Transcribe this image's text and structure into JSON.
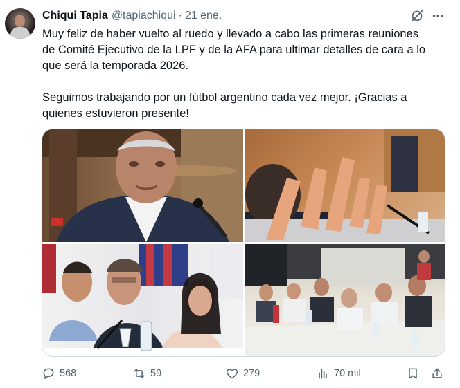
{
  "tweet": {
    "author_name": "Chiqui Tapia",
    "handle": "@tapiachiqui",
    "separator": "·",
    "date": "21 ene.",
    "paragraphs": [
      "Muy feliz de haber vuelto al ruedo y llevado a cabo las primeras reuniones\nde Comité Ejecutivo de la LPF y de la AFA para ultimar detalles de cara a lo\nque será la temporada 2026.",
      "Seguimos trabajando por un fútbol argentino cada vez mejor. ¡Gracias a\nquienes estuvieron presente!"
    ],
    "media": [
      {
        "description_icon": "photo-portrait-man-with-microphone"
      },
      {
        "description_icon": "photo-raised-hands-vote"
      },
      {
        "description_icon": "photo-three-people-at-table"
      },
      {
        "description_icon": "photo-meeting-room-table"
      }
    ],
    "metrics": {
      "replies": "568",
      "reposts": "59",
      "likes": "279",
      "views": "70 mil"
    }
  },
  "colors": {
    "text": "#0f1419",
    "secondary": "#536471",
    "border": "#cfd9de"
  }
}
